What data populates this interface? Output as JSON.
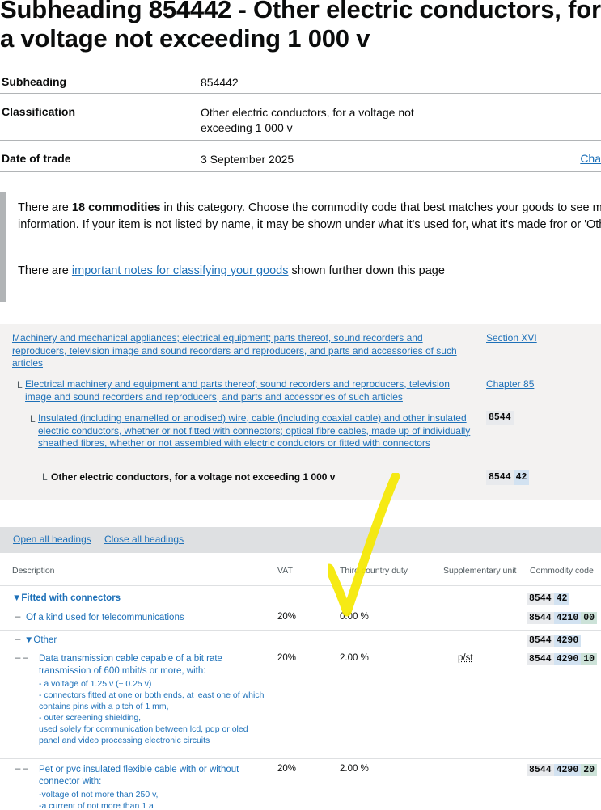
{
  "page_title": "Subheading 854442 - Other electric conductors, for a voltage not exceeding 1 000 v",
  "summary": {
    "subheading_label": "Subheading",
    "subheading_value": "854442",
    "classification_label": "Classification",
    "classification_value": "Other electric conductors, for a voltage not exceeding 1 000 v",
    "date_label": "Date of trade",
    "date_value": "3 September 2025",
    "change_link": "Cha"
  },
  "inset": {
    "p1_pre": "There are ",
    "p1_bold": "18 commodities",
    "p1_post": " in this category. Choose the commodity code that best matches your goods to see more information. If your item is not listed by name, it may be shown under what it's used for, what it's made fror or 'Other'.",
    "p2_pre": "There are ",
    "p2_link": "important notes for classifying your goods",
    "p2_post": " shown further down this page"
  },
  "breadcrumbs": {
    "section_text": "Machinery and mechanical appliances; electrical equipment; parts thereof, sound recorders and reproducers, television image and sound recorders and reproducers, and parts and accessories of such articles",
    "section_ref": "Section XVI",
    "chapter_text": "Electrical machinery and equipment and parts thereof; sound recorders and reproducers, television image and sound recorders and reproducers, and parts and accessories of such articles",
    "chapter_ref": "Chapter 85",
    "heading_text": "Insulated (including enamelled or anodised) wire, cable (including coaxial cable) and other insulated electric conductors, whether or not fitted with connectors; optical fibre cables, made up of individually sheathed fibres, whether or not assembled with electric conductors or fitted with connectors",
    "heading_code": "8544",
    "subheading_text": "Other electric conductors, for a voltage not exceeding 1 000 v",
    "subheading_code_a": "8544",
    "subheading_code_b": "42",
    "corner": "L"
  },
  "toolbar": {
    "open_all": "Open all headings",
    "close_all": "Close all headings"
  },
  "table": {
    "headers": {
      "description": "Description",
      "vat": "VAT",
      "duty": "Third country duty",
      "unit": "Supplementary unit",
      "code": "Commodity code"
    },
    "rows": {
      "fitted": {
        "label": "Fitted with connectors",
        "code_a": "8544",
        "code_b": "42"
      },
      "telecom": {
        "dash": "–",
        "label": "Of a kind used for telecommunications",
        "vat": "20%",
        "duty": "0.00 %",
        "code_a": "8544",
        "code_b": "4210",
        "code_c": "00"
      },
      "other": {
        "dash": "–",
        "label": "Other",
        "code_a": "8544",
        "code_b": "4290"
      },
      "data_cable": {
        "dash": "–  –",
        "label": "Data transmission cable capable of a bit rate transmission of 600 mbit/s or more, with:",
        "sub1": "- a voltage of 1.25 v (± 0.25 v)",
        "sub2": "- connectors fitted at one or both ends, at least one of which contains pins with a pitch of 1 mm,",
        "sub3": "- outer screening shielding,",
        "sub4": "used solely for communication between lcd, pdp or oled panel and video processing electronic circuits",
        "vat": "20%",
        "duty": "2.00 %",
        "unit": "p/st",
        "code_a": "8544",
        "code_b": "4290",
        "code_c": "10"
      },
      "pvc_cable": {
        "dash": "–  –",
        "label": "Pet or pvc insulated flexible cable with or without connector with:",
        "sub1": "-voltage of not more than 250 v,",
        "sub2": "-a current of not more than 1 a",
        "vat": "20%",
        "duty": "2.00 %",
        "code_a": "8544",
        "code_b": "4290",
        "code_c": "20"
      }
    }
  },
  "icons": {
    "triangle": "triangle-down-icon",
    "annotation": "yellow-check-mark-annotation"
  },
  "colors": {
    "link": "#1d70b8",
    "panel": "#f3f2f1",
    "toolbar": "#dee0e2",
    "highlight": "#f5e800"
  }
}
